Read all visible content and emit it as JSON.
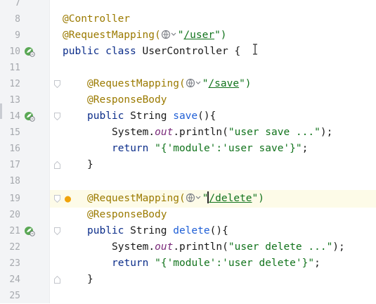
{
  "editor": {
    "lines": [
      {
        "num": "7"
      },
      {
        "num": "8",
        "t1": "@Controller"
      },
      {
        "num": "9",
        "t1": "@RequestMapping(",
        "t2": "\"",
        "t3": "/user",
        "t4": "\")"
      },
      {
        "num": "10",
        "t1": "public class ",
        "t2": "UserController {"
      },
      {
        "num": "11"
      },
      {
        "num": "12",
        "t1": "@RequestMapping(",
        "t2": "\"",
        "t3": "/save",
        "t4": "\")"
      },
      {
        "num": "13",
        "t1": "@ResponseBody"
      },
      {
        "num": "14",
        "t1": "public ",
        "t2": "String ",
        "t3": "save",
        "t4": "(){"
      },
      {
        "num": "15",
        "t1": "System.",
        "t2": "out",
        "t3": ".println(",
        "t4": "\"user save ...\"",
        "t5": ");"
      },
      {
        "num": "16",
        "t1": "return ",
        "t2": "\"{'module':'user save'}\"",
        "t3": ";"
      },
      {
        "num": "17",
        "t1": "}"
      },
      {
        "num": "18"
      },
      {
        "num": "19",
        "t1": "@RequestMapping(",
        "t2": "\"",
        "t3": "/delete",
        "t4": "\")"
      },
      {
        "num": "20",
        "t1": "@ResponseBody"
      },
      {
        "num": "21",
        "t1": "public ",
        "t2": "String ",
        "t3": "delete",
        "t4": "(){"
      },
      {
        "num": "22",
        "t1": "System.",
        "t2": "out",
        "t3": ".println(",
        "t4": "\"user delete ...\"",
        "t5": ");"
      },
      {
        "num": "23",
        "t1": "return ",
        "t2": "\"{'module':'user delete'}\"",
        "t3": ";"
      },
      {
        "num": "24",
        "t1": "}"
      },
      {
        "num": "25"
      }
    ]
  },
  "icons": {
    "bean": "spring-bean-icon",
    "globe": "web-endpoint-icon",
    "bulb": "intention-bulb-icon",
    "fold": "fold-icon"
  },
  "colors": {
    "annotation": "#9b7a00",
    "keyword": "#0b2d8a",
    "string": "#11731c",
    "method": "#1f5fd6",
    "static_field": "#7a2a7a",
    "line_number": "#a6a9ae",
    "gutter": "#f3f4f6",
    "caret_row": "#fdfbe8"
  }
}
